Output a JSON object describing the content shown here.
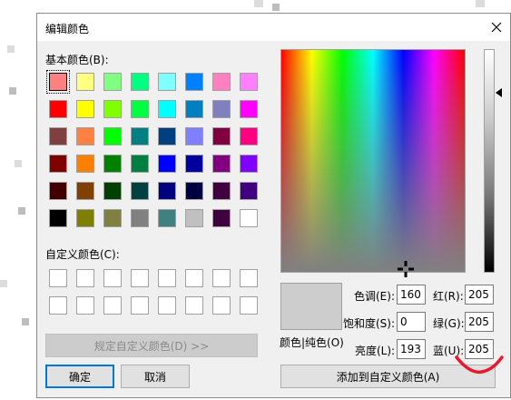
{
  "dialog": {
    "title": "编辑颜色",
    "basic_label": "基本颜色(B):",
    "custom_label": "自定义颜色(C):",
    "define_custom_label": "规定自定义颜色(D) >>",
    "ok_label": "确定",
    "cancel_label": "取消",
    "color_solid_label": "颜色|纯色(O)",
    "add_custom_label": "添加到自定义颜色(A)"
  },
  "basic_colors": [
    [
      "#ff8080",
      "#ffff80",
      "#80ff80",
      "#00ff80",
      "#80ffff",
      "#0080ff",
      "#ff80c0",
      "#ff80ff"
    ],
    [
      "#ff0000",
      "#ffff00",
      "#80ff00",
      "#00ff40",
      "#00ffff",
      "#0080c0",
      "#8080c0",
      "#ff00ff"
    ],
    [
      "#804040",
      "#ff8040",
      "#00ff00",
      "#008080",
      "#004080",
      "#8080ff",
      "#800040",
      "#ff0080"
    ],
    [
      "#800000",
      "#ff8000",
      "#008000",
      "#008040",
      "#0000ff",
      "#0000a0",
      "#800080",
      "#8000ff"
    ],
    [
      "#400000",
      "#804000",
      "#004000",
      "#004040",
      "#000080",
      "#000040",
      "#400040",
      "#400080"
    ],
    [
      "#000000",
      "#808000",
      "#808040",
      "#808080",
      "#408080",
      "#c0c0c0",
      "#400040",
      "#ffffff"
    ]
  ],
  "fields": {
    "hue_label": "色调(E):",
    "hue_value": "160",
    "sat_label": "饱和度(S):",
    "sat_value": "0",
    "lum_label": "亮度(L):",
    "lum_value": "193",
    "red_label": "红(R):",
    "red_value": "205",
    "green_label": "绿(G):",
    "green_value": "205",
    "blue_label": "蓝(U):",
    "blue_value": "205"
  },
  "selected_color": "#cdcdcd"
}
